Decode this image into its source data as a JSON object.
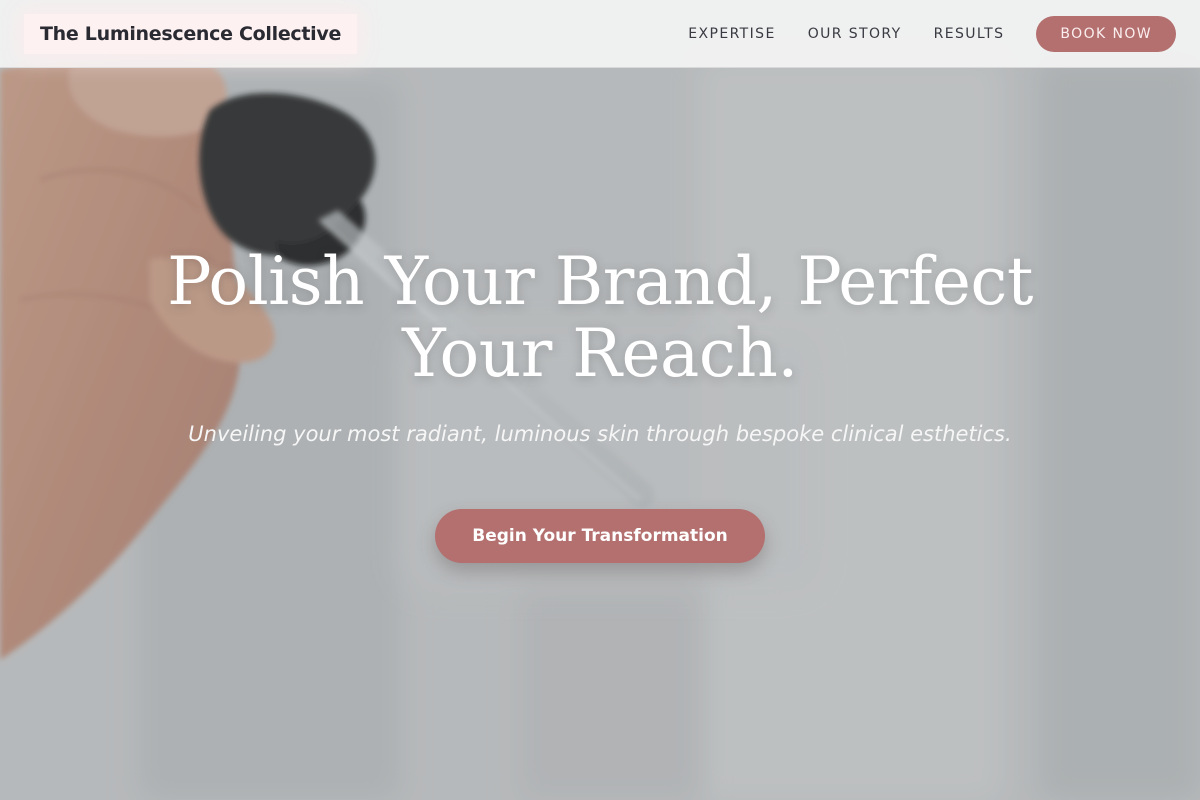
{
  "page": {
    "title": "The Luminescence Collective"
  },
  "header": {
    "brand": "The Luminescence Collective",
    "nav": [
      {
        "label": "EXPERTISE"
      },
      {
        "label": "OUR STORY"
      },
      {
        "label": "RESULTS"
      }
    ],
    "cta_label": "BOOK NOW"
  },
  "hero": {
    "headline": "Polish Your Brand, Perfect Your Reach.",
    "subheadline": "Unveiling your most radiant, luminous skin through bespoke clinical esthetics.",
    "cta_label": "Begin Your Transformation",
    "background_image": "hand holding skincare serum dropper"
  },
  "colors": {
    "accent": "#b46f6f",
    "brand_highlight": "#fdf1f1",
    "nav_text": "#3a3a42",
    "headline_text": "#ffffff"
  }
}
